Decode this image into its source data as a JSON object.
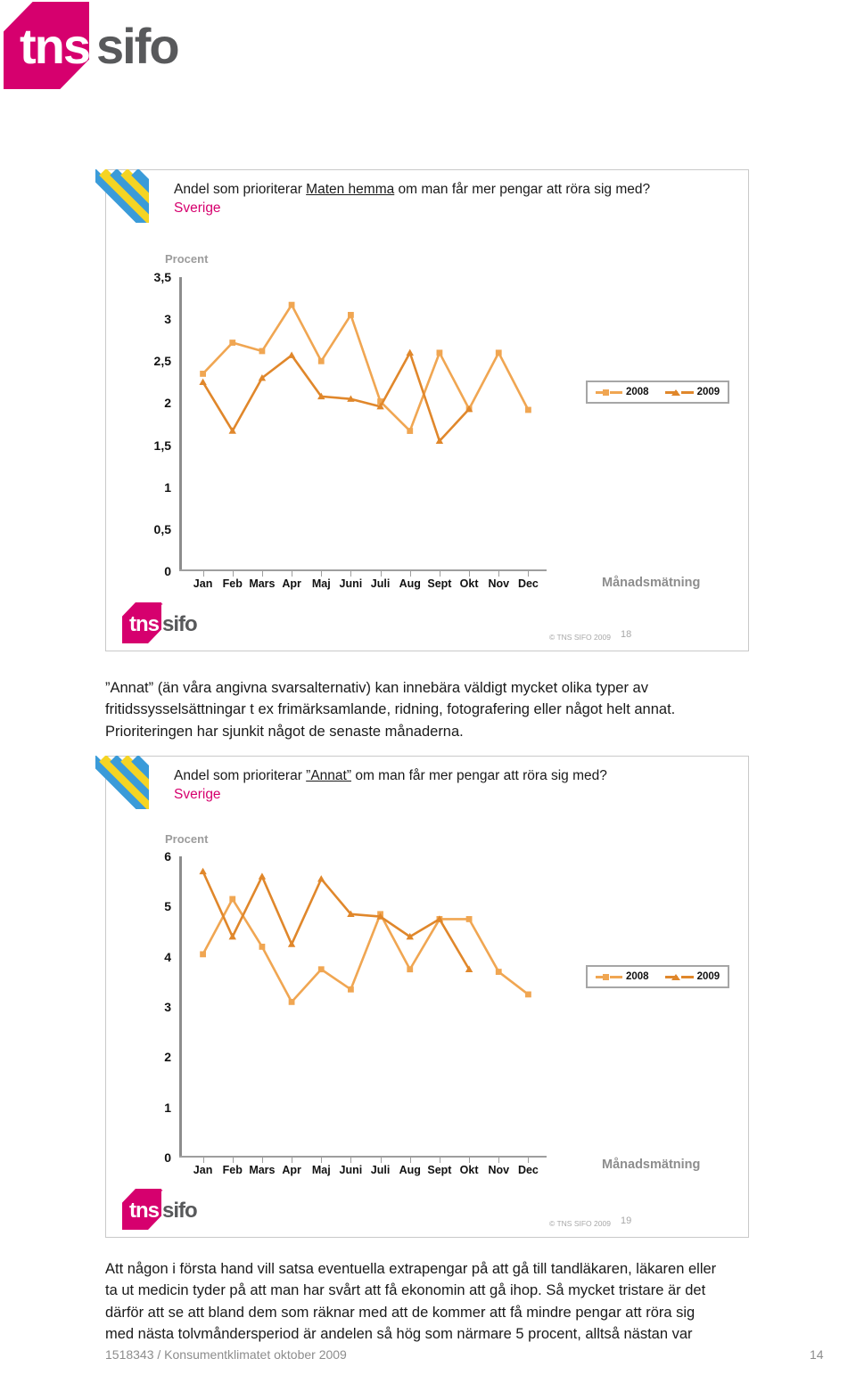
{
  "brand": {
    "logo_tns": "tns",
    "logo_sifo": "sifo",
    "trademark": "™"
  },
  "slide1": {
    "title_prefix": "Andel som prioriterar ",
    "title_underlined": "Maten hemma",
    "title_suffix": " om man får mer pengar att röra sig med?",
    "subtitle": "Sverige",
    "axis_unit": "Procent",
    "measure_label": "Månadsmätning",
    "copyright": "© TNS SIFO 2009",
    "page_number": "18",
    "legend": [
      {
        "label": "2008",
        "color": "#F0A652",
        "marker": "square"
      },
      {
        "label": "2009",
        "color": "#E0872B",
        "marker": "triangle"
      }
    ]
  },
  "slide2": {
    "title_prefix": "Andel som prioriterar ",
    "title_underlined": "”Annat”",
    "title_suffix": " om man får mer pengar att röra sig med?",
    "subtitle": "Sverige",
    "axis_unit": "Procent",
    "measure_label": "Månadsmätning",
    "copyright": "© TNS SIFO 2009",
    "page_number": "19",
    "legend": [
      {
        "label": "2008",
        "color": "#F0A652",
        "marker": "square"
      },
      {
        "label": "2009",
        "color": "#E0872B",
        "marker": "triangle"
      }
    ]
  },
  "paragraphs": {
    "middle": "”Annat” (än våra angivna svarsalternativ) kan innebära väldigt mycket olika typer av fritidssysselsättningar t ex frimärksamlande, ridning, fotografering eller något helt annat. Prioriteringen har sjunkit något de senaste månaderna.",
    "middle_lines": [
      "”Annat” (än våra angivna svarsalternativ) kan innebära väldigt mycket olika typer av",
      "fritidssysselsättningar t ex frimärksamlande, ridning, fotografering eller något helt annat.",
      "Prioriteringen har sjunkit något de senaste månaderna."
    ],
    "bottom_lines": [
      "Att någon i första hand vill satsa eventuella extrapengar på att gå till tandläkaren, läkaren eller",
      "ta ut medicin tyder på att man har svårt att få ekonomin att gå ihop. Så mycket tristare är det",
      "därför att se att bland dem som räknar med att de kommer att få mindre pengar att röra sig",
      "med nästa tolvmåndersperiod är andelen så hög som närmare 5 procent, alltså nästan var"
    ]
  },
  "document_footer": {
    "reference": "1518343 / Konsumentklimatet oktober 2009",
    "page_number": "14"
  },
  "chart_data": [
    {
      "type": "line",
      "title": "Andel som prioriterar Maten hemma om man får mer pengar att röra sig med? Sverige",
      "xlabel": "Månadsmätning",
      "ylabel": "Procent",
      "categories": [
        "Jan",
        "Feb",
        "Mars",
        "Apr",
        "Maj",
        "Juni",
        "Juli",
        "Aug",
        "Sept",
        "Okt",
        "Nov",
        "Dec"
      ],
      "yticks": [
        "0",
        "0,5",
        "1",
        "1,5",
        "2",
        "2,5",
        "3",
        "3,5"
      ],
      "ylim": [
        0,
        3.5
      ],
      "grid": false,
      "legend_position": "right",
      "series": [
        {
          "name": "2008",
          "color": "#F0A652",
          "marker": "square",
          "values": [
            2.35,
            2.72,
            2.62,
            3.17,
            2.5,
            3.05,
            2.02,
            1.67,
            2.6,
            1.93,
            2.6,
            1.92
          ]
        },
        {
          "name": "2009",
          "color": "#E0872B",
          "marker": "triangle",
          "values": [
            2.25,
            1.67,
            2.3,
            2.57,
            2.08,
            2.05,
            1.96,
            2.6,
            1.55,
            1.93,
            null,
            null
          ]
        }
      ]
    },
    {
      "type": "line",
      "title": "Andel som prioriterar ”Annat” om man får mer pengar att röra sig med? Sverige",
      "xlabel": "Månadsmätning",
      "ylabel": "Procent",
      "categories": [
        "Jan",
        "Feb",
        "Mars",
        "Apr",
        "Maj",
        "Juni",
        "Juli",
        "Aug",
        "Sept",
        "Okt",
        "Nov",
        "Dec"
      ],
      "yticks": [
        "0",
        "1",
        "2",
        "3",
        "4",
        "5",
        "6"
      ],
      "ylim": [
        0,
        6
      ],
      "grid": false,
      "legend_position": "right",
      "series": [
        {
          "name": "2008",
          "color": "#F0A652",
          "marker": "square",
          "values": [
            4.05,
            5.15,
            4.2,
            3.1,
            3.75,
            3.35,
            4.85,
            3.75,
            4.75,
            4.75,
            3.7,
            3.25
          ]
        },
        {
          "name": "2009",
          "color": "#E0872B",
          "marker": "triangle",
          "values": [
            5.7,
            4.4,
            5.6,
            4.25,
            5.55,
            4.85,
            4.8,
            4.4,
            4.75,
            3.75,
            null,
            null
          ]
        }
      ]
    }
  ]
}
